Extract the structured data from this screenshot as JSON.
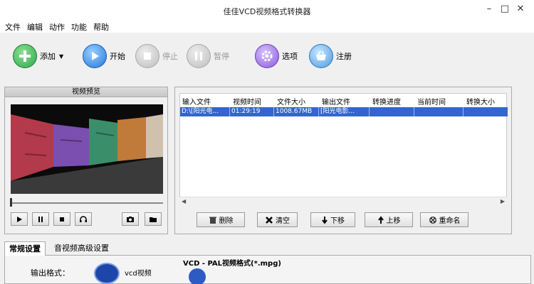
{
  "window": {
    "title": "佳佳VCD视频格式转换器"
  },
  "menu": [
    "文件",
    "编辑",
    "动作",
    "功能",
    "帮助"
  ],
  "toolbar": {
    "add": "添加",
    "start": "开始",
    "stop": "停止",
    "pause": "暂停",
    "options": "选项",
    "register": "注册"
  },
  "preview": {
    "title": "视频预览"
  },
  "filelist": {
    "columns": [
      "输入文件",
      "视频时间",
      "文件大小",
      "输出文件",
      "转换进度",
      "当前时间",
      "转换大小"
    ],
    "rows": [
      [
        "D:\\[阳光电...",
        "01:29:19",
        "1008.67MB",
        "[阳光电影...",
        "",
        "",
        ""
      ]
    ]
  },
  "actions": {
    "delete": "删除",
    "clear": "清空",
    "down": "下移",
    "up": "上移",
    "rename": "重命名"
  },
  "tabs": [
    "常规设置",
    "音视频高级设置"
  ],
  "settings": {
    "format_title": "VCD - PAL视频格式(*.mpg)",
    "output_label": "输出格式：",
    "format_text": "vcd视频"
  },
  "colors": {
    "selection": "#3366cc",
    "accent_green": "#2fa84f",
    "accent_blue": "#2277dd",
    "accent_purple": "#8a5ad8"
  }
}
